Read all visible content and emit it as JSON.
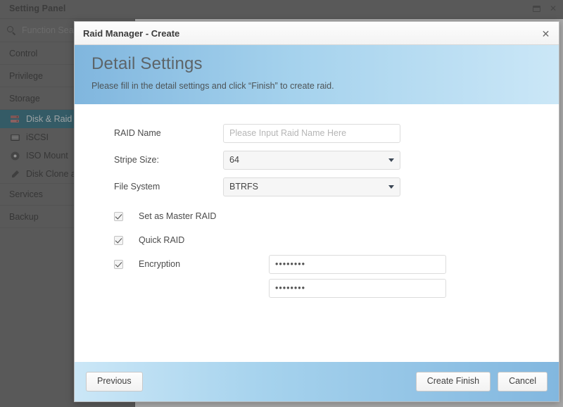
{
  "window": {
    "title": "Setting Panel",
    "restore_icon": "restore-window-icon",
    "close_icon": "close-window-icon",
    "close_label": "✕"
  },
  "sidebar": {
    "search": {
      "placeholder": "Function Search",
      "icon": "search-icon"
    },
    "items": [
      {
        "label": "Control",
        "type": "section",
        "icon": ""
      },
      {
        "label": "Privilege",
        "type": "section",
        "icon": ""
      },
      {
        "label": "Storage",
        "type": "section",
        "icon": ""
      },
      {
        "label": "Disk & Raid",
        "type": "sub",
        "icon": "disk-raid-icon",
        "active": true
      },
      {
        "label": "iSCSI",
        "type": "sub",
        "icon": "iscsi-icon",
        "active": false
      },
      {
        "label": "ISO Mount",
        "type": "sub",
        "icon": "iso-mount-icon",
        "active": false
      },
      {
        "label": "Disk Clone a",
        "type": "sub",
        "icon": "disk-clone-icon",
        "active": false
      },
      {
        "label": "Services",
        "type": "section",
        "icon": ""
      },
      {
        "label": "Backup",
        "type": "section",
        "icon": ""
      }
    ]
  },
  "dialog": {
    "title": "Raid Manager - Create",
    "close_label": "✕",
    "banner": {
      "heading": "Detail Settings",
      "subheading": "Please fill in the detail settings and click “Finish” to create raid."
    },
    "fields": {
      "raid_name": {
        "label": "RAID Name",
        "value": "",
        "placeholder": "Please Input Raid Name Here"
      },
      "stripe_size": {
        "label": "Stripe Size:",
        "value": "64",
        "options": [
          "64"
        ]
      },
      "file_system": {
        "label": "File System",
        "value": "BTRFS",
        "options": [
          "BTRFS"
        ]
      }
    },
    "checkboxes": [
      {
        "label": "Set as Master RAID",
        "checked": true
      },
      {
        "label": "Quick RAID",
        "checked": true
      },
      {
        "label": "Encryption",
        "checked": true
      }
    ],
    "passwords": {
      "password_value": "••••••••",
      "confirm_value": "••••••••"
    },
    "footer": {
      "previous_label": "Previous",
      "create_finish_label": "Create Finish",
      "cancel_label": "Cancel"
    }
  },
  "colors": {
    "accent_teal": "#2b7285",
    "banner_blue_left": "#80b6de",
    "banner_blue_right": "#cbe7f7",
    "chrome_gray": "#6e6e6e"
  }
}
